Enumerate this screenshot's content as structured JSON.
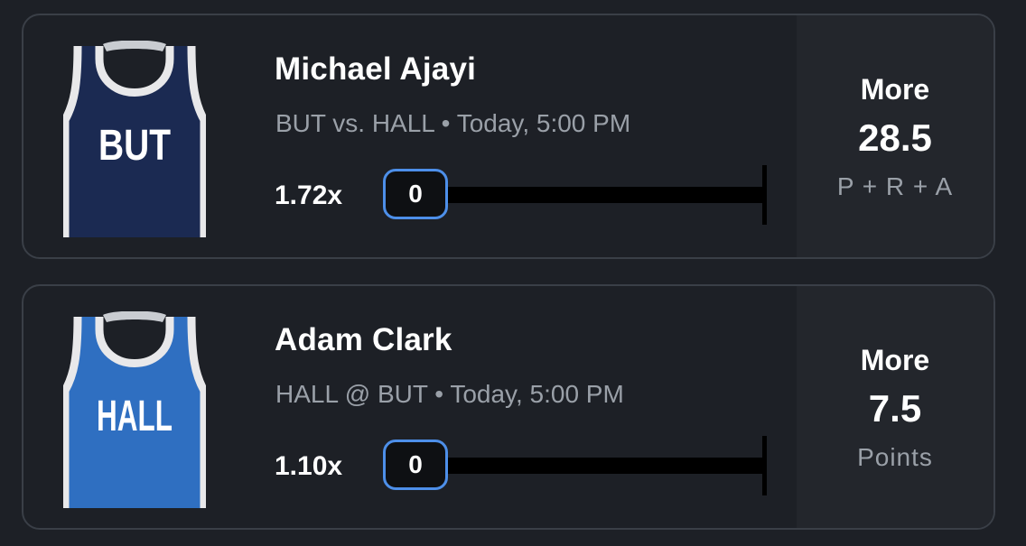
{
  "picks": [
    {
      "team_abbr": "BUT",
      "jersey_color": "#1b2a52",
      "player_name": "Michael Ajayi",
      "matchup": "BUT vs. HALL • Today, 5:00 PM",
      "multiplier": "1.72x",
      "progress_value": "0",
      "direction": "More",
      "line": "28.5",
      "stat": "P + R + A"
    },
    {
      "team_abbr": "HALL",
      "jersey_color": "#2f6fc1",
      "player_name": "Adam Clark",
      "matchup": "HALL @ BUT • Today, 5:00 PM",
      "multiplier": "1.10x",
      "progress_value": "0",
      "direction": "More",
      "line": "7.5",
      "stat": "Points"
    }
  ],
  "colors": {
    "background": "#1d2026",
    "side_panel": "#23262c",
    "pill_border": "#4d8fe9",
    "muted_text": "#9aa0a8"
  }
}
